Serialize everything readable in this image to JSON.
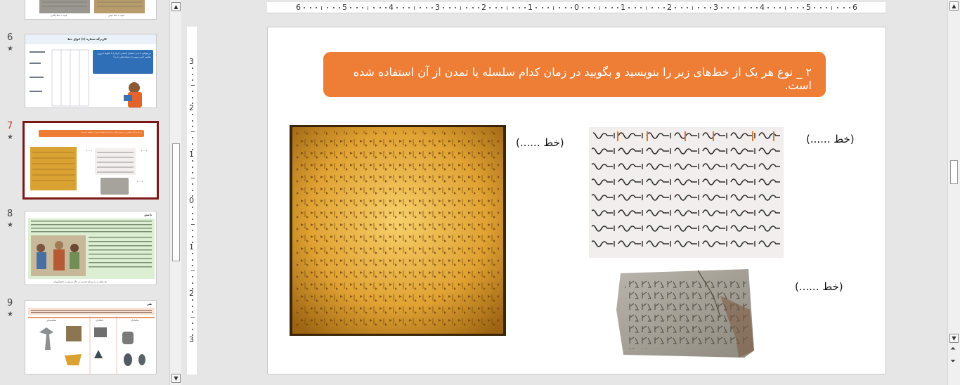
{
  "thumbnails": [
    {
      "number": "",
      "caption_a": "کتیبه به خط ایلامی",
      "caption_b": "کتیبه به خط میخی"
    },
    {
      "number": "6",
      "title": "کاربرگه شماره (۲) انواع خط",
      "box_text": "می‌خواهیم با دیدن خط‌های باستانی، آن‌ها را با خطوط امروزی مقایسه کنیم و ببینیم چه شباهت‌هایی دارند؟"
    },
    {
      "number": "7",
      "title": "۲ _ نوع هر یک از خط‌های زیر را بنویسید و بگویید در زمان کدام سلسله یا تمدن از آن استفاده شده است."
    },
    {
      "number": "8",
      "title": "دانش",
      "caption": "یک معلم در مدرسه‌ای قدیمی، در حال تدریس به دانش‌آموزان"
    },
    {
      "number": "9",
      "title": "هنر",
      "labels": [
        "هخامنشیان",
        "اشکانیان",
        "ساسانیان"
      ]
    }
  ],
  "ruler": {
    "horizontal": [
      "6",
      "5",
      "4",
      "3",
      "2",
      "1",
      "0",
      "1",
      "2",
      "3",
      "4",
      "5",
      "6"
    ],
    "vertical": [
      "3",
      "2",
      "1",
      "0",
      "1",
      "2",
      "3"
    ]
  },
  "slide": {
    "instruction": "۲ _ نوع هر یک از خط‌های زیر را بنویسید و بگویید در زمان کدام سلسله یا تمدن از آن استفاده شده است.",
    "blank_labels": [
      "(خط ......)",
      "(خط ......)",
      "(خط ......)"
    ]
  },
  "colors": {
    "banner": "#ee7d35",
    "selection_border": "#7b1717",
    "active_number": "#c0392b"
  }
}
